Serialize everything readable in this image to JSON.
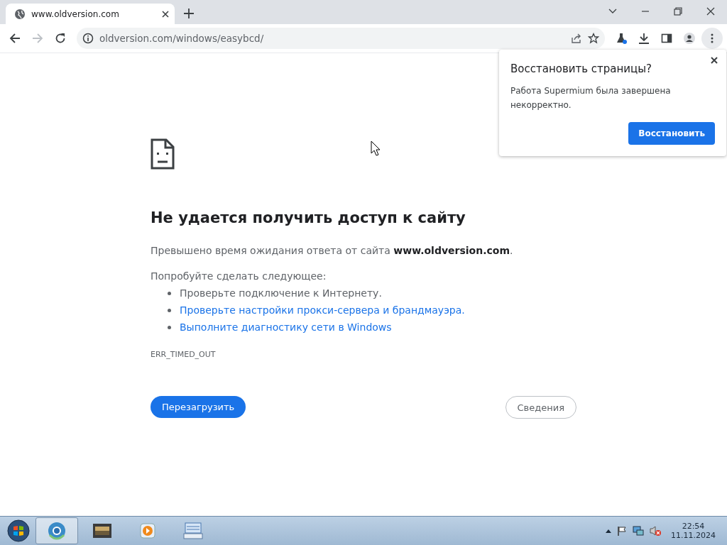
{
  "browser": {
    "tabs": [
      {
        "title": "www.oldversion.com",
        "selected": true
      }
    ],
    "address": "oldversion.com/windows/easybcd/",
    "nav": {
      "back_disabled": false,
      "forward_disabled": true
    }
  },
  "error_page": {
    "heading": "Не удается получить доступ к сайту",
    "message": "Превышено время ожидания ответа от сайта **www.oldversion.com**.",
    "try_label": "Попробуйте сделать следующее:",
    "suggestions": [
      {
        "kind": "text",
        "text": "Проверьте подключение к Интернету."
      },
      {
        "kind": "link",
        "text": "Проверьте настройки прокси-сервера и брандмауэра."
      },
      {
        "kind": "link",
        "text": "Выполните диагностику сети в Windows"
      }
    ],
    "error_code": "ERR_TIMED_OUT",
    "reload_button": "Перезагрузить",
    "details_button": "Сведения"
  },
  "restore_popup": {
    "title": "Восстановить страницы?",
    "message": "Работа Supermium была завершена некорректно.",
    "button": "Восстановить"
  },
  "taskbar": {
    "apps": [
      {
        "kind": "browser",
        "active": true
      },
      {
        "kind": "film",
        "active": false
      },
      {
        "kind": "player",
        "active": false
      },
      {
        "kind": "keyboard",
        "active": false
      }
    ],
    "time": "22:54",
    "date": "11.11.2024"
  }
}
